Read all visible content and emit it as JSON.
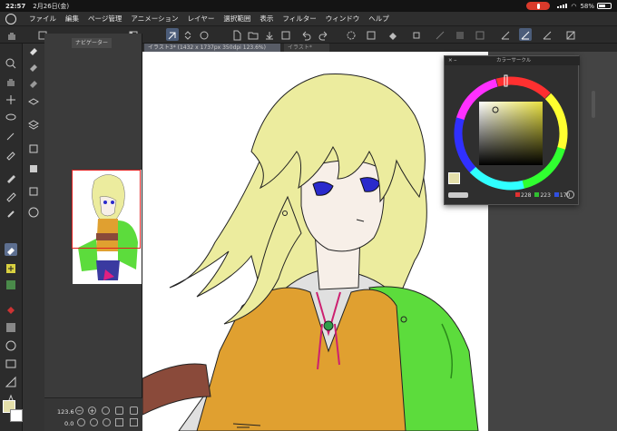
{
  "status_bar": {
    "time": "22:57",
    "date": "2月26日(金)",
    "battery": "58%"
  },
  "menu": {
    "items": [
      "ファイル",
      "編集",
      "ページ管理",
      "アニメーション",
      "レイヤー",
      "選択範囲",
      "表示",
      "フィルター",
      "ウィンドウ",
      "ヘルプ"
    ]
  },
  "navigator": {
    "tab_label": "ナビゲーター",
    "zoom": "123.6",
    "angle": "0.0"
  },
  "document_tabs": {
    "active": "イラスト3* (1432 x 1737px 350dpi 123.6%)",
    "other": "イラスト*"
  },
  "color_panel": {
    "title": "カラーサークル",
    "r": "228",
    "g": "223",
    "b": "170"
  },
  "colors": {
    "main": "#e4dfaa",
    "hair": "#ecec9e",
    "vest": "#e0a030",
    "cape": "#5cdc3c",
    "eye": "#2a2acc",
    "shirt": "#e0e0e0",
    "skin": "#f7efe8",
    "tie": "#cc2070",
    "gem": "#2f9e4a"
  }
}
